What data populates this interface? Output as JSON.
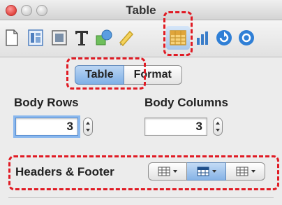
{
  "window": {
    "title": "Table"
  },
  "toolbar": {
    "icons": [
      "document-icon",
      "layout-icon",
      "media-icon",
      "text-icon",
      "shapes-icon",
      "comment-icon",
      "table-icon",
      "chart-icon",
      "link-icon",
      "query-icon"
    ],
    "selected": "table-icon"
  },
  "tabs": [
    {
      "label": "Table",
      "active": true
    },
    {
      "label": "Format",
      "active": false
    }
  ],
  "body_rows": {
    "label": "Body Rows",
    "value": "3"
  },
  "body_columns": {
    "label": "Body Columns",
    "value": "3"
  },
  "headers_footer": {
    "label": "Headers & Footer",
    "options": [
      "header-row-icon",
      "header-column-icon",
      "footer-row-icon"
    ],
    "selected_index": 1
  },
  "colors": {
    "highlight": "#e01b24",
    "accent": "#7fb0e6"
  }
}
